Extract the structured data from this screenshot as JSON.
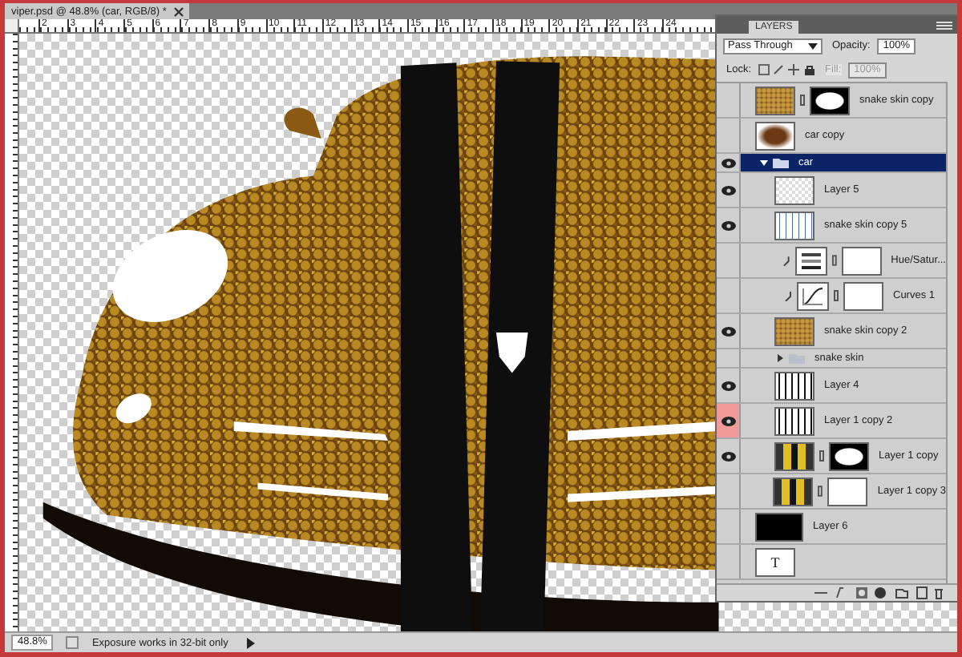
{
  "document_tab": {
    "title": "viper.psd @ 48.8% (car, RGB/8) *"
  },
  "ruler_labels": [
    "2",
    "3",
    "4",
    "5",
    "6",
    "7",
    "8",
    "9",
    "10",
    "11",
    "12",
    "13",
    "14",
    "15",
    "16",
    "17",
    "18",
    "19",
    "20",
    "21",
    "22",
    "23",
    "24"
  ],
  "layers_panel": {
    "tab": {
      "label": "LAYERS",
      "selected": true
    },
    "blend_mode": "Pass Through",
    "opacity_label": "Opacity:",
    "opacity": "100%",
    "lock_label": "Lock:",
    "fill_label": "Fill:",
    "fill": "100%",
    "fill_disabled": true,
    "layers": [
      {
        "kind": "layer",
        "name": "snake skin copy",
        "visible": false,
        "highlighted": false,
        "selected": false,
        "clipped": false,
        "thumbnail": {
          "kind": "texture"
        },
        "mask": {
          "kind": "shape"
        }
      },
      {
        "kind": "layer",
        "name": "car copy",
        "visible": false,
        "highlighted": false,
        "selected": false,
        "clipped": false,
        "thumbnail": {
          "kind": "car"
        }
      },
      {
        "kind": "group",
        "name": "car",
        "visible": true,
        "highlighted": false,
        "selected": true,
        "expanded": true,
        "children": [
          {
            "kind": "layer",
            "name": "Layer 5",
            "visible": true,
            "highlighted": false,
            "selected": false,
            "clipped": false,
            "thumbnail": {
              "kind": "checker"
            }
          },
          {
            "kind": "layer",
            "name": "snake skin copy 5",
            "visible": true,
            "highlighted": false,
            "selected": false,
            "clipped": false,
            "thumbnail": {
              "kind": "stripe"
            }
          },
          {
            "kind": "layer",
            "name": "Hue/Satur...",
            "visible": false,
            "highlighted": false,
            "selected": false,
            "clipped": true,
            "thumbnail": {
              "kind": "hue"
            },
            "mask": {
              "kind": "white"
            }
          },
          {
            "kind": "layer",
            "name": "Curves 1",
            "visible": false,
            "highlighted": false,
            "selected": false,
            "clipped": true,
            "thumbnail": {
              "kind": "curves"
            },
            "mask": {
              "kind": "white"
            }
          },
          {
            "kind": "layer",
            "name": "snake skin copy 2",
            "visible": true,
            "highlighted": false,
            "selected": false,
            "clipped": false,
            "thumbnail": {
              "kind": "texture"
            }
          },
          {
            "kind": "group",
            "name": "snake skin",
            "visible": false,
            "highlighted": false,
            "selected": false,
            "expanded": false
          },
          {
            "kind": "layer",
            "name": "Layer 4",
            "visible": true,
            "highlighted": false,
            "selected": false,
            "clipped": false,
            "thumbnail": {
              "kind": "outline"
            }
          },
          {
            "kind": "layer",
            "name": "Layer 1 copy 2",
            "visible": true,
            "highlighted": true,
            "selected": false,
            "clipped": false,
            "thumbnail": {
              "kind": "outline"
            }
          },
          {
            "kind": "layer",
            "name": "Layer 1 copy",
            "visible": true,
            "highlighted": false,
            "selected": false,
            "clipped": false,
            "thumbnail": {
              "kind": "yellow"
            },
            "mask": {
              "kind": "shape"
            }
          },
          {
            "kind": "layer",
            "name": "Layer 1 copy 3",
            "visible": false,
            "highlighted": false,
            "selected": false,
            "clipped": false,
            "thumbnail": {
              "kind": "yellow"
            },
            "mask": {
              "kind": "white"
            }
          }
        ]
      },
      {
        "kind": "layer",
        "name": "Layer 6",
        "visible": false,
        "highlighted": false,
        "selected": false,
        "clipped": false,
        "thumbnail": {
          "kind": "black"
        }
      },
      {
        "kind": "layer",
        "visible": false,
        "highlighted": false,
        "selected": false,
        "clipped": false,
        "thumbnail": {
          "kind": "text",
          "text": "T"
        }
      }
    ]
  },
  "status_bar": {
    "zoom": "48.8%",
    "message": "Exposure works in 32-bit only"
  }
}
